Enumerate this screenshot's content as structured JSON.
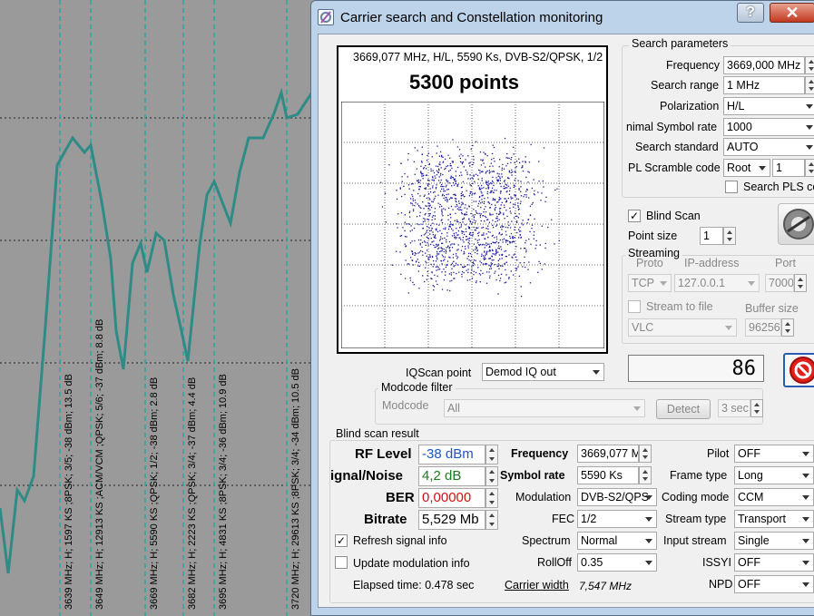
{
  "background": {
    "scan_labels": [
      "3639 MHz; H; 1597 KS ;8PSK; 3/5; -38 dBm; 13.5 dB",
      "3649 MHz; H; 12913 KS ;ACM/VCM ;QPSK; 5/6; -37 dBm; 8.8 dB",
      "3669 MHz; H; 5590 KS ;QPSK; 1/2; -38 dBm; 2.8 dB",
      "3682 MHz; H; 2223 KS ;QPSK; 3/4; -37 dBm; 4.4 dB",
      "3695 MHz; H; 4831 KS ;8PSK; 3/4; -36 dBm; 10.9 dB",
      "3720 MHz; H; 29613 KS ;8PSK; 3/4; -34 dBm; 10.5 dB"
    ],
    "trace_color": "#2e8b86"
  },
  "window": {
    "title": "Carrier search and Constellation monitoring",
    "help_label": "?",
    "close_label": "✕"
  },
  "constellation": {
    "info": "3669,077 MHz, H/L, 5590 Ks, DVB-S2/QPSK, 1/2",
    "points_label": "5300 points",
    "dot_color": "#1a1a9c"
  },
  "iqscan": {
    "label": "IQScan point",
    "value": "Demod IQ out"
  },
  "modcode": {
    "group_title": "Modcode filter",
    "label": "Modcode",
    "value": "All",
    "detect_label": "Detect",
    "sec_value": "3 sec"
  },
  "search": {
    "group_title": "Search parameters",
    "frequency_label": "Frequency",
    "frequency_value": "3669,000 MHz",
    "range_label": "Search range",
    "range_value": "1 MHz",
    "polarization_label": "Polarization",
    "polarization_value": "H/L",
    "min_sr_label": "nimal Symbol rate",
    "min_sr_value": "1000",
    "standard_label": "Search standard",
    "standard_value": "AUTO",
    "pls_label": "PL Scramble code",
    "pls_mode": "Root",
    "pls_value": "1",
    "search_pls_label": "Search PLS co",
    "blind_scan_label": "Blind Scan",
    "point_size_label": "Point size",
    "point_size_value": "1"
  },
  "streaming": {
    "group_title": "Streaming",
    "proto_label": "Proto",
    "ip_label": "IP-address",
    "port_label": "Port",
    "proto_value": "TCP",
    "ip_value": "127.0.0.1",
    "port_value": "7000",
    "stream_to_file_label": "Stream to file",
    "buffer_label": "Buffer size",
    "player_value": "VLC",
    "buffer_value": "96256"
  },
  "counter_value": "86",
  "result": {
    "group_title": "Blind scan result",
    "rf_label": "RF Level",
    "rf_value": "-38 dBm",
    "rf_color": "#1a55c4",
    "snr_label": "ignal/Noise",
    "snr_value": "4,2 dB",
    "snr_color": "#1e7a1e",
    "ber_label": "BER",
    "ber_value": "0,00000",
    "ber_color": "#d01010",
    "bitrate_label": "Bitrate",
    "bitrate_value": "5,529 Mb",
    "frequency_label": "Frequency",
    "frequency_value": "3669,077 M",
    "symbol_rate_label": "Symbol rate",
    "symbol_rate_value": "5590 Ks",
    "modulation_label": "Modulation",
    "modulation_value": "DVB-S2/QPS",
    "fec_label": "FEC",
    "fec_value": "1/2",
    "spectrum_label": "Spectrum",
    "spectrum_value": "Normal",
    "rolloff_label": "RollOff",
    "rolloff_value": "0.35",
    "pilot_label": "Pilot",
    "pilot_value": "OFF",
    "frame_label": "Frame type",
    "frame_value": "Long",
    "coding_label": "Coding mode",
    "coding_value": "CCM",
    "stream_type_label": "Stream type",
    "stream_type_value": "Transport",
    "input_stream_label": "Input stream",
    "input_stream_value": "Single",
    "issyi_label": "ISSYI",
    "issyi_value": "OFF",
    "npd_label": "NPD",
    "npd_value": "OFF",
    "refresh_label": "Refresh signal info",
    "update_mod_label": "Update modulation info",
    "elapsed_label": "Elapsed time: 0.478 sec",
    "carrier_width_label": "Carrier width",
    "carrier_width_value": "7,547 MHz"
  }
}
